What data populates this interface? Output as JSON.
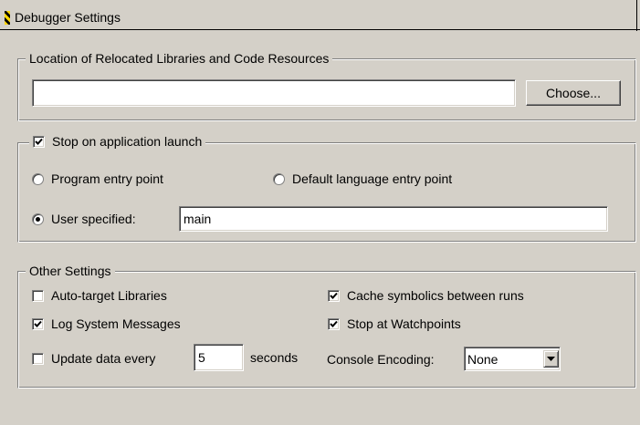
{
  "window": {
    "title": "Debugger Settings",
    "icon": "debugger-panel-icon"
  },
  "relocated": {
    "legend": "Location of Relocated Libraries and Code Resources",
    "path_value": "",
    "choose_label": "Choose..."
  },
  "launch": {
    "stop_label": "Stop on application launch",
    "stop_checked": true,
    "program_entry_label": "Program entry point",
    "default_lang_label": "Default language entry point",
    "user_specified_label": "User specified:",
    "user_specified_value": "main",
    "selected": "user_specified"
  },
  "other": {
    "legend": "Other Settings",
    "auto_target_label": "Auto-target Libraries",
    "auto_target_checked": false,
    "log_system_label": "Log System Messages",
    "log_system_checked": true,
    "update_data_label": "Update data every",
    "update_data_checked": false,
    "update_interval_value": "5",
    "seconds_label": "seconds",
    "cache_symbolics_label": "Cache symbolics between runs",
    "cache_symbolics_checked": true,
    "stop_watchpoints_label": "Stop at Watchpoints",
    "stop_watchpoints_checked": true,
    "console_encoding_label": "Console Encoding:",
    "console_encoding_value": "None"
  }
}
